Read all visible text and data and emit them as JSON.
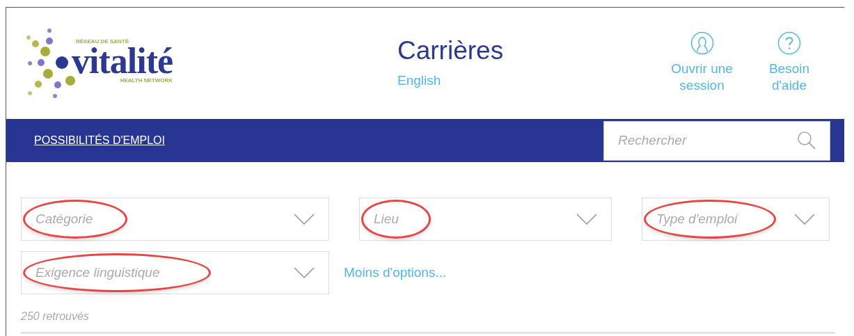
{
  "logo": {
    "tagline_top": "RÉSEAU DE SANTÉ",
    "name": "vitalité",
    "tagline_bottom": "HEALTH NETWORK"
  },
  "header": {
    "title": "Carrières",
    "language_link": "English"
  },
  "header_links": [
    {
      "kind": "user",
      "label": [
        "Ouvrir une",
        "session"
      ]
    },
    {
      "kind": "help",
      "label": [
        "Besoin",
        "d'aide"
      ]
    }
  ],
  "nav": {
    "items": [
      {
        "label": "POSSIBILITÉS D'EMPLOI"
      }
    ],
    "search": {
      "placeholder": "Rechercher"
    }
  },
  "filters": [
    {
      "placeholder": "Catégorie",
      "highlighted": true
    },
    {
      "placeholder": "Lieu",
      "highlighted": true
    },
    {
      "placeholder": "Type d'emploi",
      "highlighted": true
    },
    {
      "placeholder": "Exigence linguistique",
      "highlighted": true
    }
  ],
  "less_options_link": "Moins d'options...",
  "result_count": "250 retrouvés"
}
